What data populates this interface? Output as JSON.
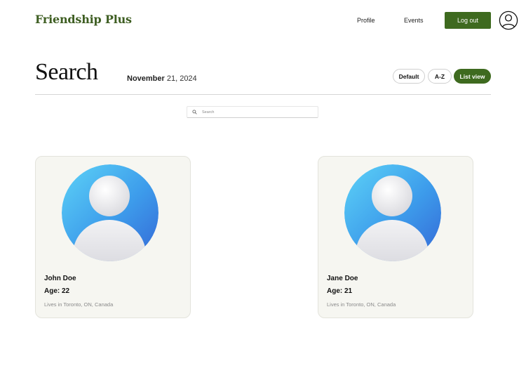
{
  "header": {
    "brand": "Friendship Plus",
    "nav": {
      "profile": "Profile",
      "events": "Events"
    },
    "logout_label": "Log out",
    "user_icon": "user-circle-icon"
  },
  "page": {
    "title": "Search",
    "date_month": "November",
    "date_rest": " 21, 2024"
  },
  "sort_options": {
    "default": "Default",
    "az": "A-Z",
    "list_view": "List view"
  },
  "search": {
    "placeholder": "Search",
    "value": ""
  },
  "profiles": [
    {
      "name": "John Doe",
      "age": "Age: 22",
      "location": "Lives in Toronto, ON, Canada",
      "avatar": "default-avatar-icon"
    },
    {
      "name": "Jane Doe",
      "age": "Age: 21",
      "location": "Lives in Toronto, ON, Canada",
      "avatar": "default-avatar-icon"
    }
  ],
  "colors": {
    "brand": "#3e5e22",
    "accent": "#3e6a1f",
    "card_bg": "#f6f6f1",
    "avatar_blue": "#3a8de8"
  }
}
